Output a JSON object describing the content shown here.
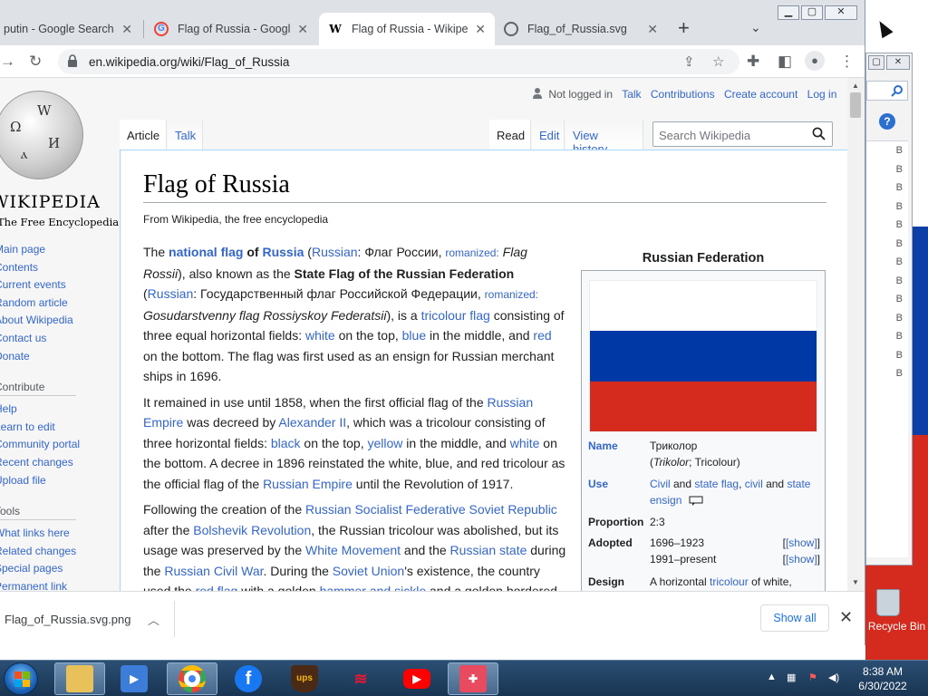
{
  "browser": {
    "tabs": [
      {
        "title": "putin - Google Search",
        "favicon": "google-icon",
        "active": false
      },
      {
        "title": "Flag of Russia - Google",
        "favicon": "google-icon",
        "active": false
      },
      {
        "title": "Flag of Russia - Wikipedi",
        "favicon": "wikipedia-icon",
        "active": true
      },
      {
        "title": "Flag_of_Russia.svg",
        "favicon": "globe-icon",
        "active": false
      }
    ],
    "url": "en.wikipedia.org/wiki/Flag_of_Russia"
  },
  "wiki": {
    "logo": {
      "wordmark": "WIKIPEDIA",
      "tagline": "The Free Encyclopedia"
    },
    "personal": {
      "status": "Not logged in",
      "talk": "Talk",
      "contributions": "Contributions",
      "create": "Create account",
      "login": "Log in"
    },
    "tabs": {
      "article": "Article",
      "talk": "Talk",
      "read": "Read",
      "edit": "Edit",
      "history": "View history"
    },
    "search_placeholder": "Search Wikipedia",
    "sidebar": {
      "nav": [
        "Main page",
        "Contents",
        "Current events",
        "Random article",
        "About Wikipedia",
        "Contact us",
        "Donate"
      ],
      "contribute_header": "Contribute",
      "contribute": [
        "Help",
        "Learn to edit",
        "Community portal",
        "Recent changes",
        "Upload file"
      ],
      "tools_header": "Tools",
      "tools": [
        "What links here",
        "Related changes",
        "Special pages",
        "Permanent link"
      ]
    },
    "title": "Flag of Russia",
    "from": "From Wikipedia, the free encyclopedia",
    "infobox": {
      "caption": "Russian Federation",
      "flag_colors": [
        "#ffffff",
        "#0039a6",
        "#d52b1e"
      ],
      "rows": {
        "name_label": "Name",
        "name_value": "Триколор",
        "name_sub_a": "Trikolor",
        "name_sub_b": "; Tricolour)",
        "use_label": "Use",
        "use_civil": "Civil",
        "use_and1": " and ",
        "use_state_flag": "state flag",
        "use_comma": ", ",
        "use_civil2": "civil",
        "use_and2": " and ",
        "use_state": "state",
        "use_ensign": "ensign",
        "proportion_label": "Proportion",
        "proportion_value": "2:3",
        "adopted_label": "Adopted",
        "adopted_1": "1696–1923",
        "adopted_2": "1991–present",
        "show": "[show]",
        "design_label": "Design",
        "design_value_a": "A horizontal ",
        "design_link": "tricolour",
        "design_value_b": " of white,"
      }
    }
  },
  "download": {
    "filename": "Flag_of_Russia.svg.png",
    "show_all": "Show all"
  },
  "desktop": {
    "recycle_bin": "Recycle Bin",
    "bg_rows": [
      "B",
      "B",
      "B",
      "B",
      "B",
      "B",
      "B",
      "B",
      "B",
      "B",
      "B",
      "B",
      "B"
    ]
  },
  "taskbar": {
    "time": "8:38 AM",
    "date": "6/30/2022"
  }
}
